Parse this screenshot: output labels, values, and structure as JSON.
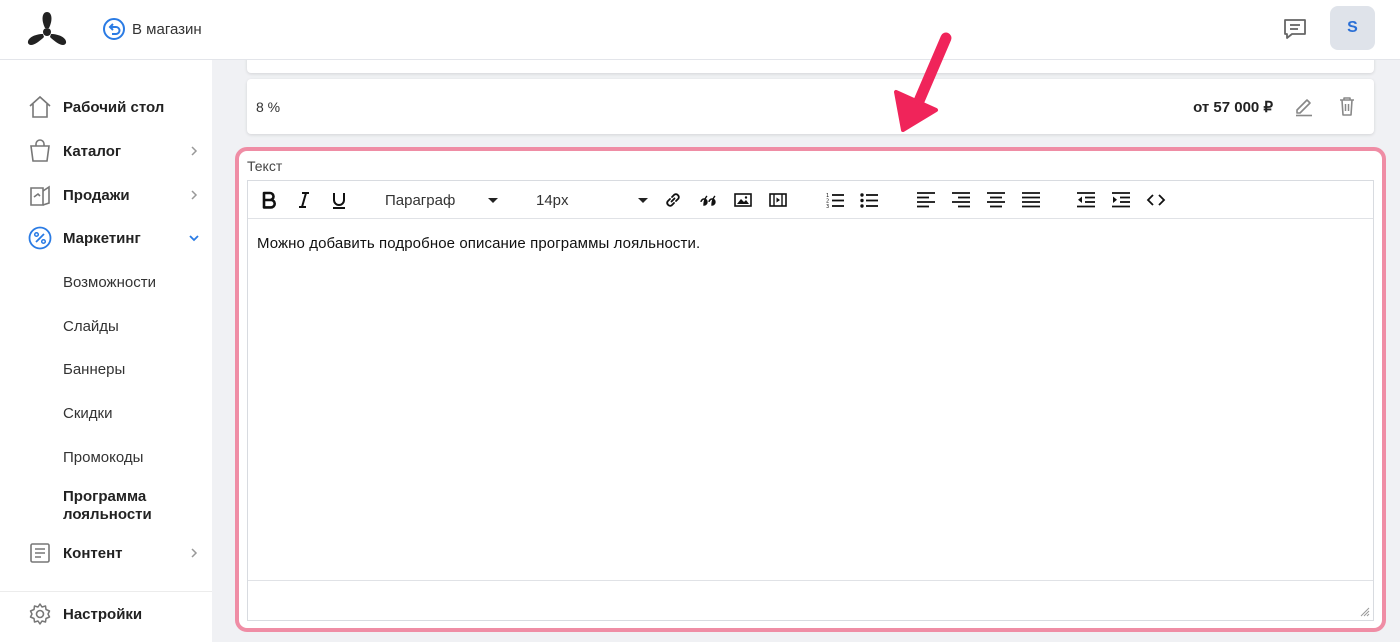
{
  "header": {
    "back_label": "В магазин",
    "avatar_initial": "S"
  },
  "sidebar": {
    "items": [
      {
        "label": "Рабочий стол",
        "icon": "home-icon"
      },
      {
        "label": "Каталог",
        "icon": "bag-icon"
      },
      {
        "label": "Продажи",
        "icon": "sales-icon"
      },
      {
        "label": "Маркетинг",
        "icon": "percent-icon"
      },
      {
        "label": "Контент",
        "icon": "content-icon"
      },
      {
        "label": "Настройки",
        "icon": "gear-icon"
      }
    ],
    "marketing_sub": [
      "Возможности",
      "Слайды",
      "Баннеры",
      "Скидки",
      "Промокоды",
      "Программа лояльности"
    ]
  },
  "loyalty_level": {
    "percent": "8 %",
    "threshold": "от 57 000 ₽"
  },
  "editor": {
    "field_label": "Текст",
    "paragraph_select": "Параграф",
    "size_select": "14px",
    "content": "Можно добавить подробное описание программы лояльности."
  },
  "colors": {
    "accent": "#2a7be4",
    "highlight": "#ef8da5",
    "arrow": "#f0245a"
  }
}
